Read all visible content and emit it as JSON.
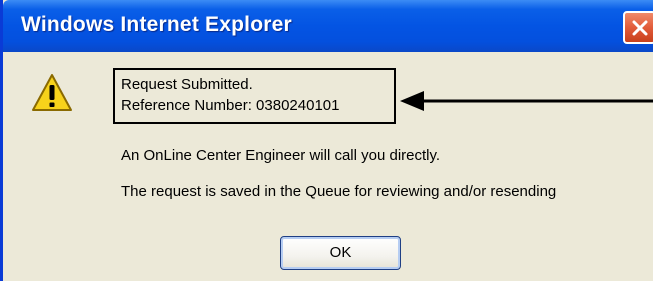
{
  "window": {
    "title": "Windows Internet Explorer",
    "close_icon": "close-icon"
  },
  "message": {
    "icon": "warning-icon",
    "line1": "Request Submitted.",
    "line2": "Reference Number: 0380240101",
    "line3": "An OnLine Center Engineer will call you directly.",
    "line4": "The request is saved in the Queue for reviewing and/or resending"
  },
  "buttons": {
    "ok_label": "OK"
  },
  "annotation": {
    "highlight_box": "callout-box",
    "arrow": "arrow-icon"
  },
  "colors": {
    "titlebar": "#0454e3",
    "dialog_bg": "#ece9d8",
    "close_button": "#e25c3a"
  }
}
